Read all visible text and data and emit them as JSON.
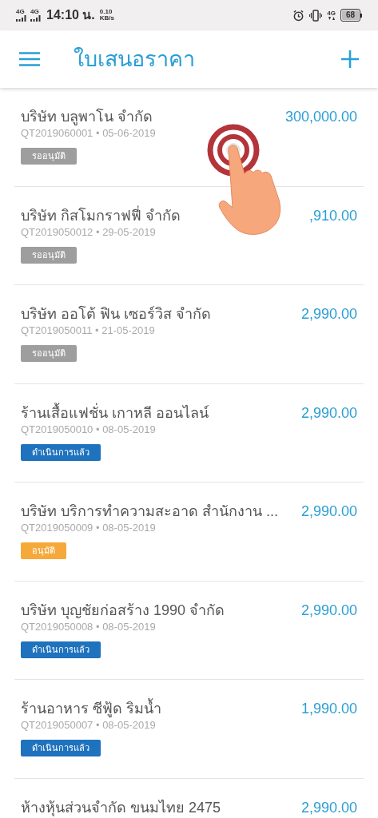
{
  "status_bar": {
    "network_1": "4G",
    "network_2": "4G",
    "time": "14:10 น.",
    "speed": "0.10",
    "speed_unit": "KB/s",
    "network_3": "4G",
    "battery": "68"
  },
  "app_bar": {
    "title": "ใบเสนอราคา"
  },
  "quotes": [
    {
      "company": "บริษัท บลูพาโน จำกัด",
      "number": "QT2019060001 • 05-06-2019",
      "amount": "300,000.00",
      "status": {
        "label": "รออนุมัติ",
        "kind": "pending"
      }
    },
    {
      "company": "บริษัท กิสโมกราฟฟี่ จำกัด",
      "number": "QT2019050012 • 29-05-2019",
      "amount": ",910.00",
      "status": {
        "label": "รออนุมัติ",
        "kind": "pending"
      }
    },
    {
      "company": "บริษัท ออโต้ ฟิน เซอร์วิส จำกัด",
      "number": "QT2019050011 • 21-05-2019",
      "amount": "2,990.00",
      "status": {
        "label": "รออนุมัติ",
        "kind": "pending"
      }
    },
    {
      "company": "ร้านเสื้อแฟชั่น เกาหลี ออนไลน์",
      "number": "QT2019050010 • 08-05-2019",
      "amount": "2,990.00",
      "status": {
        "label": "ดำเนินการแล้ว",
        "kind": "done"
      }
    },
    {
      "company": "บริษัท บริการทำความสะอาด สำนักงาน ...",
      "number": "QT2019050009 • 08-05-2019",
      "amount": "2,990.00",
      "status": {
        "label": "อนุมัติ",
        "kind": "approved"
      }
    },
    {
      "company": "บริษัท บุญชัยก่อสร้าง 1990 จำกัด",
      "number": "QT2019050008 • 08-05-2019",
      "amount": "2,990.00",
      "status": {
        "label": "ดำเนินการแล้ว",
        "kind": "done"
      }
    },
    {
      "company": "ร้านอาหาร ซีฟู้ด ริมน้ำ",
      "number": "QT2019050007 • 08-05-2019",
      "amount": "1,990.00",
      "status": {
        "label": "ดำเนินการแล้ว",
        "kind": "done"
      }
    },
    {
      "company": "ห้างหุ้นส่วนจำกัด ขนมไทย 2475",
      "amount": "2,990.00"
    }
  ]
}
